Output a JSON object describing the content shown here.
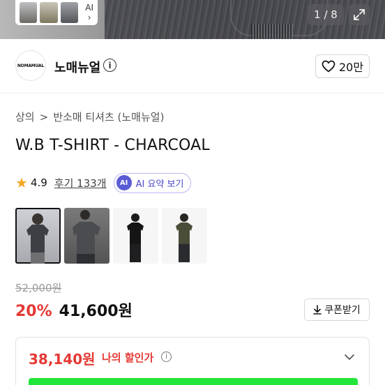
{
  "hero": {
    "thumb_tag": "AI",
    "thumb_chevron": "›",
    "image_counter": "1 / 8",
    "expand_icon": "expand-icon"
  },
  "brand": {
    "logo_text": "NOMAMUAL",
    "name": "노매뉴얼",
    "info_icon": "info-icon",
    "like_count": "20만"
  },
  "breadcrumb": {
    "category": "상의",
    "separator": ">",
    "subcategory": "반소매 티셔츠 (노매뉴얼)"
  },
  "product": {
    "title": "W.B T-SHIRT - CHARCOAL",
    "rating": "4.9",
    "reviews": "후기 133개",
    "ai_badge": "AI",
    "ai_summary": "AI 요약 보기"
  },
  "gallery": {
    "items": [
      "photo-1",
      "photo-2",
      "photo-3",
      "photo-4"
    ],
    "selected_index": 0
  },
  "price": {
    "original": "52,000원",
    "discount": "20%",
    "current": "41,600원",
    "coupon_label": "쿠폰받기"
  },
  "my_price": {
    "value": "38,140원",
    "label": "나의 할인가",
    "info": "i"
  },
  "colors": {
    "accent_red": "#e53935",
    "ai_purple": "#5b5bd6",
    "star": "#f5a623",
    "green_bar": "#22e53a"
  }
}
